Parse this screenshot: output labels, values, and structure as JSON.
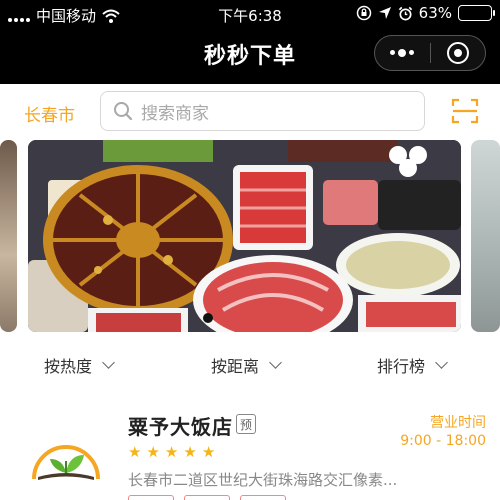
{
  "status_bar": {
    "carrier": "中国移动",
    "time": "下午6:38",
    "battery": "63%",
    "battery_level": 0.63
  },
  "nav": {
    "title": "秒秒下单"
  },
  "search": {
    "city": "长春市",
    "placeholder": "搜索商家"
  },
  "banner": {
    "slides": 1,
    "active_index": 0
  },
  "filters": [
    "按热度",
    "按距离",
    "排行榜"
  ],
  "restaurant": {
    "name": "粟予大饭店",
    "tag": "预",
    "rating": 5,
    "star_glyph": "★",
    "hours_label": "营业时间",
    "hours": "9:00 - 18:00",
    "address": "长春市二道区世纪大街珠海路交汇像素..."
  },
  "colors": {
    "accent": "#f5a623",
    "star": "#f5b417",
    "nav_bg": "#000000"
  },
  "icons": [
    "signal-icon",
    "wifi-icon",
    "lock-rotation-icon",
    "location-icon",
    "alarm-icon",
    "battery-icon",
    "more-icon",
    "close-mini-program-icon",
    "search-icon",
    "scan-icon",
    "chevron-down-icon"
  ]
}
